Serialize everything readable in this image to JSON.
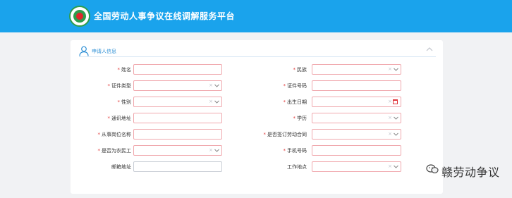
{
  "header": {
    "title": "全国劳动人事争议在线调解服务平台"
  },
  "section": {
    "title": "申请人信息"
  },
  "fields": {
    "name": {
      "label": "姓名",
      "required": true
    },
    "ethnicity": {
      "label": "民族",
      "required": true
    },
    "id_type": {
      "label": "证件类型",
      "required": true
    },
    "id_number": {
      "label": "证件号码",
      "required": true
    },
    "gender": {
      "label": "性别",
      "required": true
    },
    "birth_date": {
      "label": "出生日期",
      "required": true
    },
    "address": {
      "label": "通讯地址",
      "required": true
    },
    "education": {
      "label": "学历",
      "required": true
    },
    "position": {
      "label": "从事岗位名称",
      "required": true
    },
    "labor_contract": {
      "label": "是否签订劳动合同",
      "required": true
    },
    "migrant_worker": {
      "label": "是否为农民工",
      "required": true
    },
    "phone": {
      "label": "手机号码",
      "required": true
    },
    "postal_address": {
      "label": "邮箱地址",
      "required": false
    },
    "work_location": {
      "label": "工作地点",
      "required": false
    }
  },
  "common": {
    "required_mark": "*",
    "clear_glyph": "×"
  },
  "watermark": {
    "text": "赣劳动争议"
  },
  "colors": {
    "header": "#1aa3ec",
    "accent": "#2d8fd5",
    "required": "#e23b3b",
    "error_border": "#f0a9ae"
  }
}
